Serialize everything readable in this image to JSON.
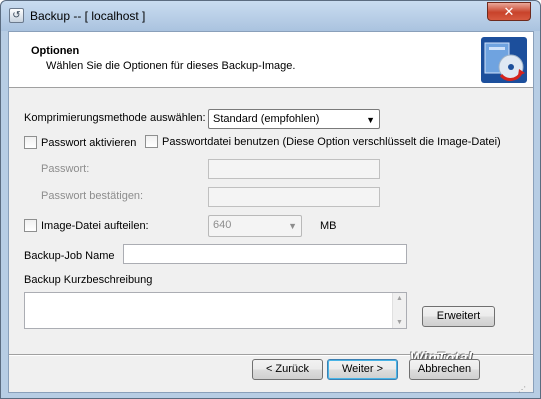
{
  "window": {
    "title": "Backup -- [ localhost ]",
    "close_label": "✕"
  },
  "header": {
    "title": "Optionen",
    "subtitle": "Wählen Sie die Optionen für dieses Backup-Image."
  },
  "compression": {
    "label": "Komprimierungsmethode auswählen:",
    "value": "Standard (empfohlen)"
  },
  "password": {
    "enable_label": "Passwort aktivieren",
    "enable_checked": false,
    "file_label": "Passwortdatei benutzen (Diese Option verschlüsselt die Image-Datei)",
    "file_checked": false,
    "password_label": "Passwort:",
    "confirm_label": "Passwort bestätigen:"
  },
  "split": {
    "label": "Image-Datei aufteilen:",
    "checked": false,
    "size_value": "640",
    "unit": "MB"
  },
  "job": {
    "name_label": "Backup-Job Name",
    "name_value": "",
    "description_label": "Backup Kurzbeschreibung",
    "description_value": ""
  },
  "buttons": {
    "advanced": "Erweitert",
    "back": "< Zurück",
    "next": "Weiter >",
    "cancel": "Abbrechen"
  },
  "watermark": "WinTotal",
  "icons": {
    "app": "backup-app-icon",
    "header_logo": "backup-disc-icon"
  }
}
